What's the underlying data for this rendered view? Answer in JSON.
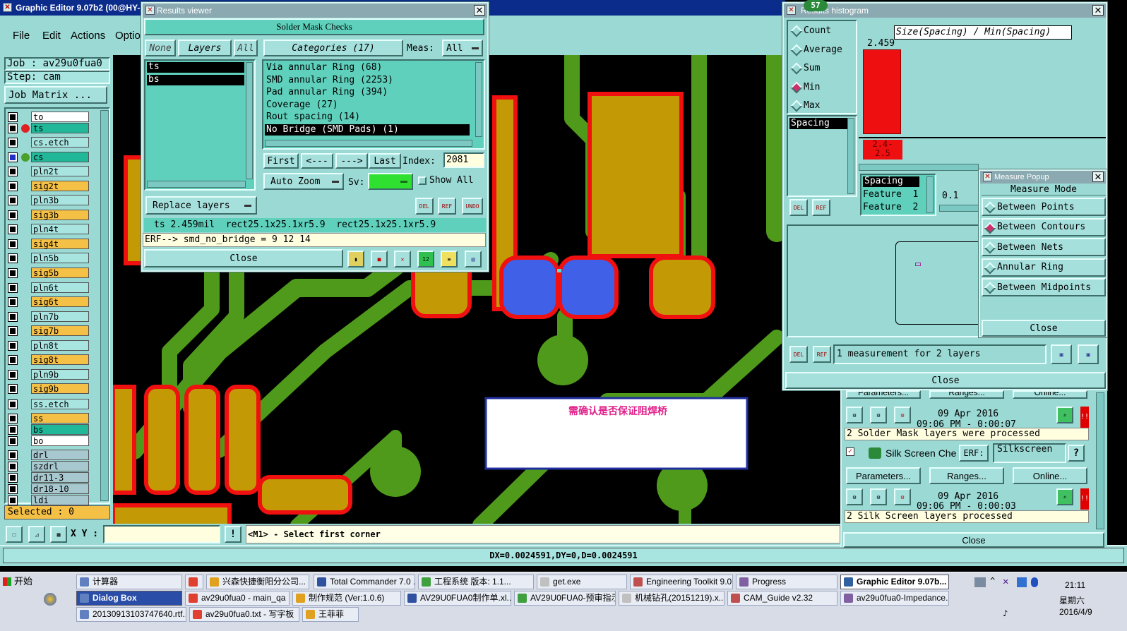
{
  "main_window": {
    "title": "Graphic Editor 9.07b2 (00@HY-H",
    "menu": [
      "File",
      "Edit",
      "Actions",
      "Optio"
    ],
    "job_label": "Job : av29u0fua0",
    "step_label": "Step: cam",
    "job_matrix_button": "Job Matrix ...",
    "layers": [
      {
        "name": "to",
        "color": "#ffffff",
        "selected": false
      },
      {
        "name": "ts",
        "color": "#21b89a",
        "selected": true,
        "dot": "#e02020"
      },
      {
        "name": "cs.etch",
        "color": "#a8e4e0",
        "selected": false
      },
      {
        "name": "cs",
        "color": "#21b89a",
        "selected": true,
        "dot": "#4aa028"
      },
      {
        "name": "pln2t",
        "color": "#a8e4e0"
      },
      {
        "name": "sig2t",
        "color": "#f5c046"
      },
      {
        "name": "pln3b",
        "color": "#a8e4e0"
      },
      {
        "name": "sig3b",
        "color": "#f5c046"
      },
      {
        "name": "pln4t",
        "color": "#a8e4e0"
      },
      {
        "name": "sig4t",
        "color": "#f5c046"
      },
      {
        "name": "pln5b",
        "color": "#a8e4e0"
      },
      {
        "name": "sig5b",
        "color": "#f5c046"
      },
      {
        "name": "pln6t",
        "color": "#a8e4e0"
      },
      {
        "name": "sig6t",
        "color": "#f5c046"
      },
      {
        "name": "pln7b",
        "color": "#a8e4e0"
      },
      {
        "name": "sig7b",
        "color": "#f5c046"
      },
      {
        "name": "pln8t",
        "color": "#a8e4e0"
      },
      {
        "name": "sig8t",
        "color": "#f5c046"
      },
      {
        "name": "pln9b",
        "color": "#a8e4e0"
      },
      {
        "name": "sig9b",
        "color": "#f5c046"
      },
      {
        "name": "ss.etch",
        "color": "#a8e4e0"
      },
      {
        "name": "ss",
        "color": "#f5c046"
      },
      {
        "name": "bs",
        "color": "#21b89a"
      },
      {
        "name": "bo",
        "color": "#ffffff"
      },
      {
        "name": "drl",
        "color": "#a8c8d0"
      },
      {
        "name": "szdrl",
        "color": "#a8c8d0"
      },
      {
        "name": "dr11-3",
        "color": "#a8c8d0"
      },
      {
        "name": "dr18-10",
        "color": "#a8c8d0"
      },
      {
        "name": "ldi",
        "color": "#a8c8d0"
      }
    ],
    "selected_label": "Selected : 0",
    "xy_label": "X Y :",
    "status_hint": "<M1> - Select first corner",
    "dx_readout": "DX=0.0024591,DY=0,D=0.0024591",
    "annotation_text": "需确认是否保证阻焊桥"
  },
  "results_viewer": {
    "title": "Results viewer",
    "header": "Solder Mask Checks",
    "filter_buttons": [
      "None",
      "Layers",
      "All"
    ],
    "categories_header": "Categories (17)",
    "meas_label": "Meas:",
    "meas_value": "All",
    "layer_list": [
      "ts",
      "bs"
    ],
    "categories": [
      "Via annular Ring (68)",
      "SMD annular Ring (2253)",
      "Pad annular Ring (394)",
      "Coverage (27)",
      "Rout spacing (14)",
      "No Bridge (SMD Pads) (1)"
    ],
    "nav": {
      "first": "First",
      "prev": "<---",
      "next": "--->",
      "last": "Last",
      "index_label": "Index:",
      "index_value": "2081"
    },
    "auto_zoom": "Auto Zoom",
    "sv_label": "Sv:",
    "show_all": "Show All",
    "replace_layers": "Replace layers",
    "icons": [
      "DEL",
      "REF",
      "UNDO"
    ],
    "result_line": "ts 2.459mil  rect25.1x25.1xr5.9  rect25.1x25.1xr5.9",
    "erf_line": "ERF--> smd_no_bridge = 9 12 14",
    "close": "Close"
  },
  "histogram": {
    "title": "Results histogram",
    "badge": "57",
    "modes": [
      {
        "label": "Count",
        "on": false
      },
      {
        "label": "Average",
        "on": false
      },
      {
        "label": "Sum",
        "on": false
      },
      {
        "label": "Min",
        "on": true
      },
      {
        "label": "Max",
        "on": false
      }
    ],
    "list_item": "Spacing",
    "axis_title": "Size(Spacing) / Min(Spacing)",
    "bar_value": "2.459",
    "bar_range": "2.4-\n2.5",
    "bar_fraction": 1.0,
    "detail": [
      "Spacing",
      "Feature  1",
      "Feature  2"
    ],
    "scale_value": "0.1",
    "icons": [
      "DEL",
      "REF"
    ],
    "summary": "1 measurement for 2 layers",
    "close": "Close"
  },
  "measure_popup": {
    "title": "Measure Popup",
    "heading": "Measure Mode",
    "modes": [
      {
        "label": "Between Points",
        "on": false
      },
      {
        "label": "Between Contours",
        "on": true
      },
      {
        "label": "Between Nets",
        "on": false
      },
      {
        "label": "Annular Ring",
        "on": false
      },
      {
        "label": "Between Midpoints",
        "on": false
      }
    ],
    "close": "Close"
  },
  "progress": {
    "tabs": [
      "Parameters...",
      "Ranges...",
      "Online..."
    ],
    "solder_date": "09 Apr 2016",
    "solder_time": "09:06 PM - 0:00:07",
    "solder_msg": "2 Solder Mask layers were processed",
    "silk_title": "Silk Screen Che",
    "erf_label": "ERF:",
    "erf_value": "Silkscreen",
    "silk_date": "09 Apr 2016",
    "silk_time": "09:06 PM - 0:00:03",
    "silk_msg": "2 Silk Screen layers processed",
    "close": "Close"
  },
  "taskbar": {
    "start": "开始",
    "row1": [
      "计算器",
      "",
      "兴森快捷衡阳分公司...",
      "Total Commander 7.0 ...",
      "工程系统  版本: 1.1...",
      "get.exe",
      "Engineering Toolkit 9.0...",
      "Progress",
      "Graphic Editor 9.07b..."
    ],
    "row2": [
      "Dialog Box",
      "av29u0fua0 - main_qa",
      "制作规范 (Ver:1.0.6)",
      "AV29U0FUA0制作单.xl...",
      "AV29U0FUA0-预审指示...",
      "机械钻孔(20151219).x...",
      "CAM_Guide v2.32",
      "av29u0fua0-Impedance..."
    ],
    "row3": [
      "20130913103747640.rtf...",
      "av29u0fua0.txt - 写字板",
      "王菲菲"
    ],
    "time": "21:11",
    "weekday": "星期六",
    "date": "2016/4/9"
  }
}
